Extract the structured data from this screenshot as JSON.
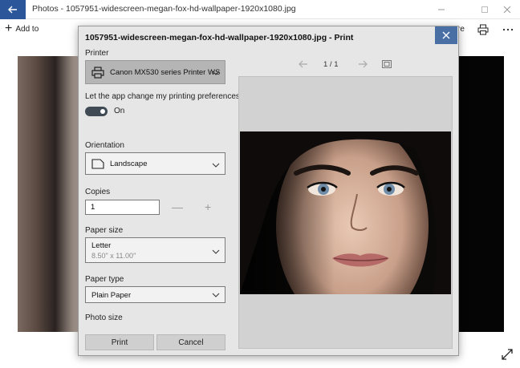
{
  "window": {
    "title": "Photos - 1057951-widescreen-megan-fox-hd-wallpaper-1920x1080.jpg"
  },
  "toolbar": {
    "add_to_label": "Add to",
    "share_fragment": "re",
    "print_icon": "printer-icon",
    "more_icon": "more-icon"
  },
  "dialog": {
    "title": "1057951-widescreen-megan-fox-hd-wallpaper-1920x1080.jpg - Print",
    "printer_label": "Printer",
    "printer_value": "Canon MX530 series Printer WS",
    "app_pref_label": "Let the app change my printing preferences",
    "app_pref_state": "On",
    "orientation_label": "Orientation",
    "orientation_value": "Landscape",
    "copies_label": "Copies",
    "copies_value": "1",
    "paper_size_label": "Paper size",
    "paper_size_value": "Letter",
    "paper_size_dims": "8.50\" x 11.00\"",
    "paper_type_label": "Paper type",
    "paper_type_value": "Plain Paper",
    "photo_size_label": "Photo size",
    "print_button": "Print",
    "cancel_button": "Cancel",
    "page_indicator": "1  /  1"
  },
  "colors": {
    "accent": "#2b579a",
    "close_button": "#4a6fa5",
    "dialog_bg": "#e6e6e6",
    "toggle_on": "#3f4a55",
    "arrow": "#e8201a"
  }
}
